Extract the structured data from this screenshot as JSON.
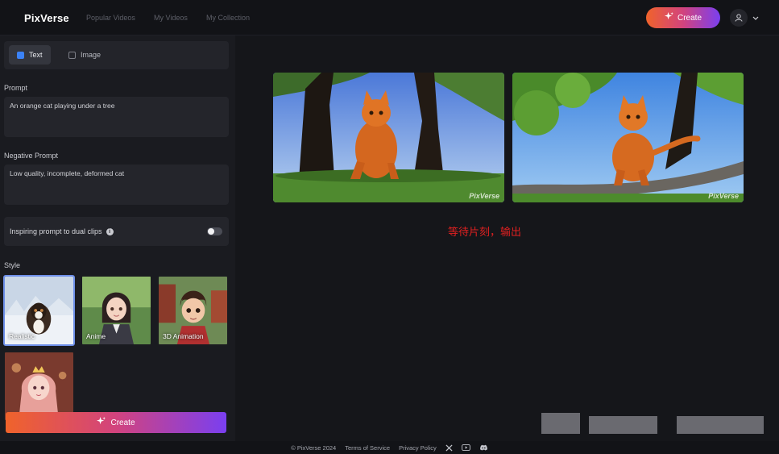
{
  "app": {
    "logo": "PixVerse",
    "nav": [
      "Popular Videos",
      "My Videos",
      "My Collection"
    ],
    "create_label": "Create",
    "user_icon": "user-icon",
    "dropdown_icon": "chevron-down-icon"
  },
  "sidebar": {
    "tabs": [
      {
        "label": "Text",
        "icon": "text-icon",
        "active": true
      },
      {
        "label": "Image",
        "icon": "image-icon",
        "active": false
      }
    ],
    "prompt_label": "Prompt",
    "prompt_value": "An orange cat playing under a tree",
    "negative_label": "Negative Prompt",
    "negative_value": "Low quality, incomplete, deformed cat",
    "dual_label": "Inspiring prompt to dual clips",
    "dual_enabled": false,
    "style_label": "Style",
    "styles": [
      {
        "name": "Realistic",
        "selected": true
      },
      {
        "name": "Anime",
        "selected": false
      },
      {
        "name": "3D Animation",
        "selected": false
      },
      {
        "name": "",
        "selected": false
      }
    ],
    "create_label": "Create"
  },
  "main": {
    "results": [
      {
        "watermark": "PixVerse"
      },
      {
        "watermark": "PixVerse"
      }
    ],
    "annotation": "等待片刻，输出"
  },
  "footer": {
    "copyright": "© PixVerse 2024",
    "terms": "Terms of Service",
    "privacy": "Privacy Policy",
    "icons": [
      "x-icon",
      "youtube-icon",
      "discord-icon"
    ]
  },
  "colors": {
    "accent_gradient": [
      "#f0632b",
      "#d2437e",
      "#7a3ff0"
    ],
    "tab_active_icon": "#3b82f6",
    "selected_border": "#6d8fe8",
    "annotation": "#e02020"
  }
}
